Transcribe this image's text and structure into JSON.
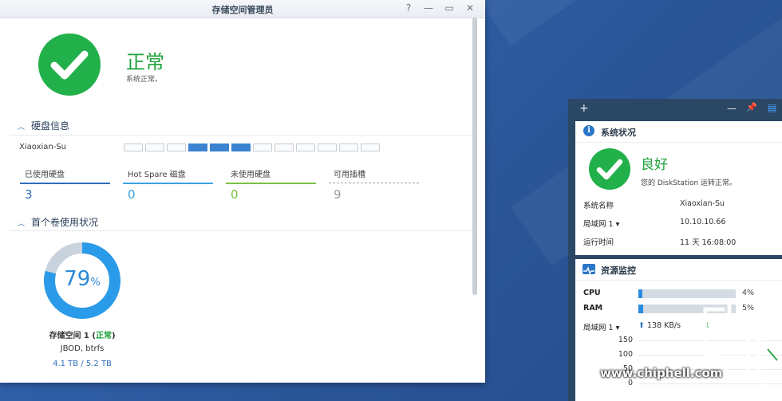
{
  "window": {
    "title": "存储空间管理员",
    "help": "?",
    "minimize": "—",
    "maximize": "▭",
    "close": "✕"
  },
  "status": {
    "title": "正常",
    "subtitle": "系统正常。"
  },
  "disk_section": {
    "header": "硬盘信息",
    "server_name": "Xiaoxian-Su",
    "slots_used_fraction": 0.25,
    "stats": [
      {
        "label": "已使用硬盘",
        "value": "3",
        "color": "#2f6eb8"
      },
      {
        "label": "Hot Spare 磁盘",
        "value": "0",
        "color": "#3aa3e0"
      },
      {
        "label": "未使用硬盘",
        "value": "0",
        "color": "#7ac143"
      },
      {
        "label": "可用插槽",
        "value": "9",
        "color": "#9aa0a6"
      }
    ]
  },
  "volume_section": {
    "header": "首个卷使用状况",
    "percent": 79,
    "percent_symbol": "%",
    "volume_name": "存储空间 1 (",
    "volume_status": "正常",
    "volume_close": ")",
    "fs": "JBOD, btrfs",
    "capacity": "4.1 TB / 5.2 TB"
  },
  "panel": {
    "add": "+",
    "minimize": "—",
    "pin": "📌",
    "layout": "▤"
  },
  "system_status": {
    "header": "系统状况",
    "state": "良好",
    "message": "您的 DiskStation 运转正常。",
    "rows": [
      {
        "key": "系统名称",
        "value": "Xiaoxian-Su"
      },
      {
        "key": "局域网 1 ▾",
        "value": "10.10.10.66"
      },
      {
        "key": "运行时间",
        "value": "11 天 16:08:00"
      }
    ]
  },
  "resource_monitor": {
    "header": "资源监控",
    "cpu_label": "CPU",
    "cpu_value": "4%",
    "cpu_fraction": 0.04,
    "ram_label": "RAM",
    "ram_value": "5%",
    "ram_fraction": 0.05,
    "lan_label": "局域网 1 ▾",
    "upload": "138 KB/s",
    "axis": [
      "150",
      "100",
      "50",
      "0"
    ]
  },
  "watermark": "www.chiphell.com",
  "colors": {
    "accent": "#3b82d0",
    "ok_green": "#22b04a"
  }
}
